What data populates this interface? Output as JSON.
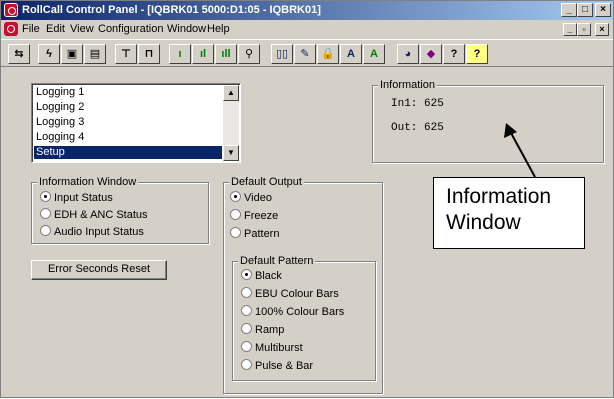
{
  "window": {
    "title": "RollCall Control Panel - [IQBRK01 5000:D1:05 - IQBRK01]",
    "min_btn": "_",
    "max_btn": "□",
    "close_btn": "×"
  },
  "menu": {
    "items": [
      "File",
      "Edit",
      "View",
      "Configuration",
      "Window",
      "Help"
    ],
    "mdi_min": "_",
    "mdi_restore": "▫",
    "mdi_close": "×"
  },
  "toolbar": {
    "buttons": [
      {
        "icon": "connect-icon",
        "glyph": "⇆"
      },
      {
        "icon": "lightning-icon",
        "glyph": "ϟ"
      },
      {
        "icon": "save-icon",
        "glyph": "▣"
      },
      {
        "icon": "save-all-icon",
        "glyph": "▤"
      },
      {
        "icon": "network-icon",
        "glyph": "⊤"
      },
      {
        "icon": "device-icon",
        "glyph": "⊓"
      },
      {
        "icon": "bar-low-icon",
        "glyph": "ı"
      },
      {
        "icon": "bar-mid-icon",
        "glyph": "ıl"
      },
      {
        "icon": "bar-high-icon",
        "glyph": "ıll"
      },
      {
        "icon": "search-icon",
        "glyph": "⚲"
      },
      {
        "icon": "book-icon",
        "glyph": "▯▯"
      },
      {
        "icon": "edit-icon",
        "glyph": "✎"
      },
      {
        "icon": "lock-icon",
        "glyph": "🔒"
      },
      {
        "icon": "font-a-icon",
        "glyph": "A"
      },
      {
        "icon": "font-a-green-icon",
        "glyph": "A"
      },
      {
        "icon": "globe-icon",
        "glyph": "◕"
      },
      {
        "icon": "eraser-icon",
        "glyph": "◆"
      },
      {
        "icon": "help-icon",
        "glyph": "?"
      },
      {
        "icon": "context-help-icon",
        "glyph": "?"
      }
    ]
  },
  "log_list": {
    "items": [
      "Logging 1",
      "Logging 2",
      "Logging 3",
      "Logging 4",
      "Setup"
    ],
    "selected_index": 4,
    "scroll_up": "▲",
    "scroll_down": "▼"
  },
  "information": {
    "legend": "Information",
    "line1": "In1: 625",
    "line2": "Out: 625"
  },
  "information_window": {
    "legend": "Information Window",
    "options": [
      "Input Status",
      "EDH & ANC Status",
      "Audio Input Status"
    ],
    "selected_index": 0
  },
  "error_reset": {
    "label": "Error Seconds Reset"
  },
  "default_output": {
    "legend": "Default Output",
    "options": [
      "Video",
      "Freeze",
      "Pattern"
    ],
    "selected_index": 0
  },
  "default_pattern": {
    "legend": "Default Pattern",
    "options": [
      "Black",
      "EBU Colour Bars",
      "100% Colour Bars",
      "Ramp",
      "Multiburst",
      "Pulse & Bar"
    ],
    "selected_index": 0
  },
  "annotation": {
    "line1": "Information",
    "line2": "Window"
  },
  "colors": {
    "titlebar": "#0a246a",
    "face": "#d4d0c8",
    "selection": "#0a246a"
  }
}
